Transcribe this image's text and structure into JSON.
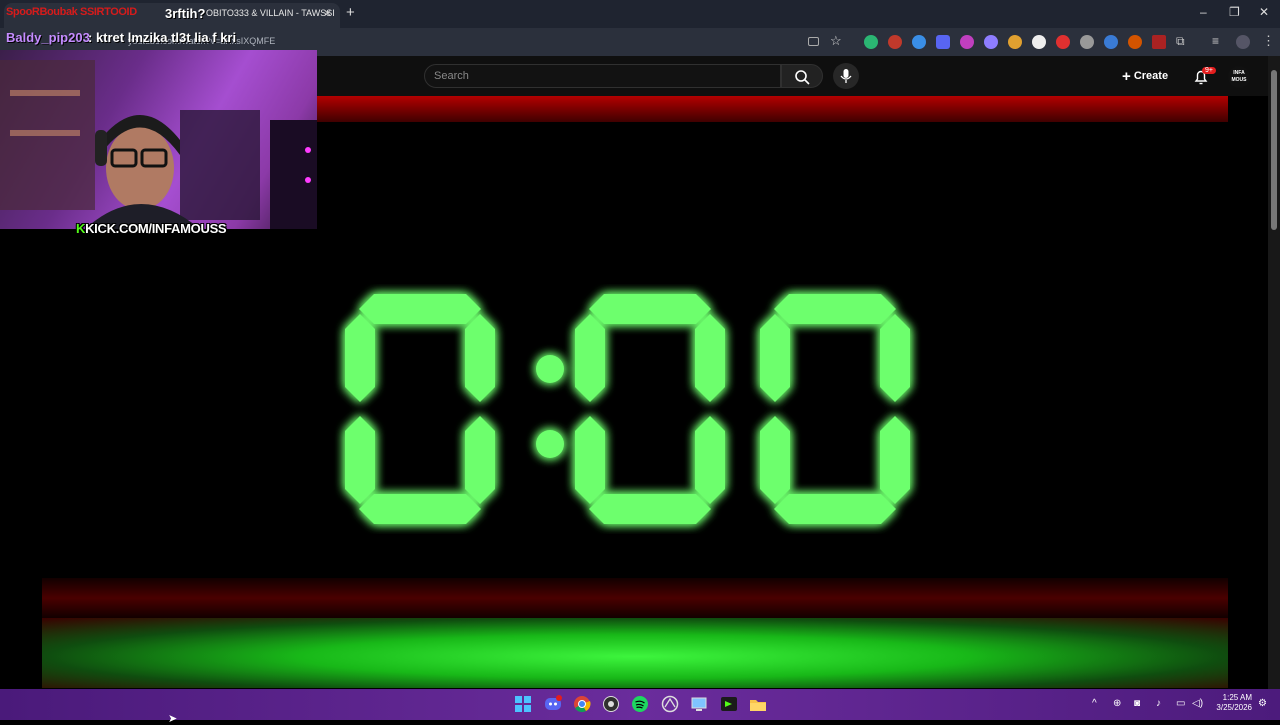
{
  "browser": {
    "tab_title": "OBITO333 & VILLAIN - TAWSSI",
    "tab_close": "×",
    "new_tab": "+",
    "url": "youtube.com/watch?v=aHxsIXQMFE",
    "window_controls": {
      "minimize": "–",
      "maximize": "❐",
      "close": "✕"
    }
  },
  "chat": {
    "prefix": "SpooRBoubak SSIRTOOID",
    "message_1": "3rftih?",
    "username": "Baldy_pip203",
    "message_2": ": ktret lmzika tl3t lia f kri"
  },
  "youtube": {
    "search_placeholder": "Search",
    "create_label": "Create",
    "notification_count": "9+",
    "avatar_text": "INFA MOUS"
  },
  "video": {
    "clock_display": "0:00",
    "colors": {
      "digit": "#6dff6d",
      "glow": "#1fd21f",
      "accent_red": "#b40000"
    }
  },
  "webcam": {
    "k_letter": "K",
    "channel_label": "KICK.COM/INFAMOUSS"
  },
  "taskbar": {
    "time": "1:25 AM",
    "date": "3/25/2026",
    "icons": [
      "windows-start-icon",
      "discord-icon",
      "chrome-icon",
      "obs-icon",
      "spotify-icon",
      "app-icon",
      "screen-icon",
      "terminal-icon",
      "file-explorer-icon"
    ]
  }
}
